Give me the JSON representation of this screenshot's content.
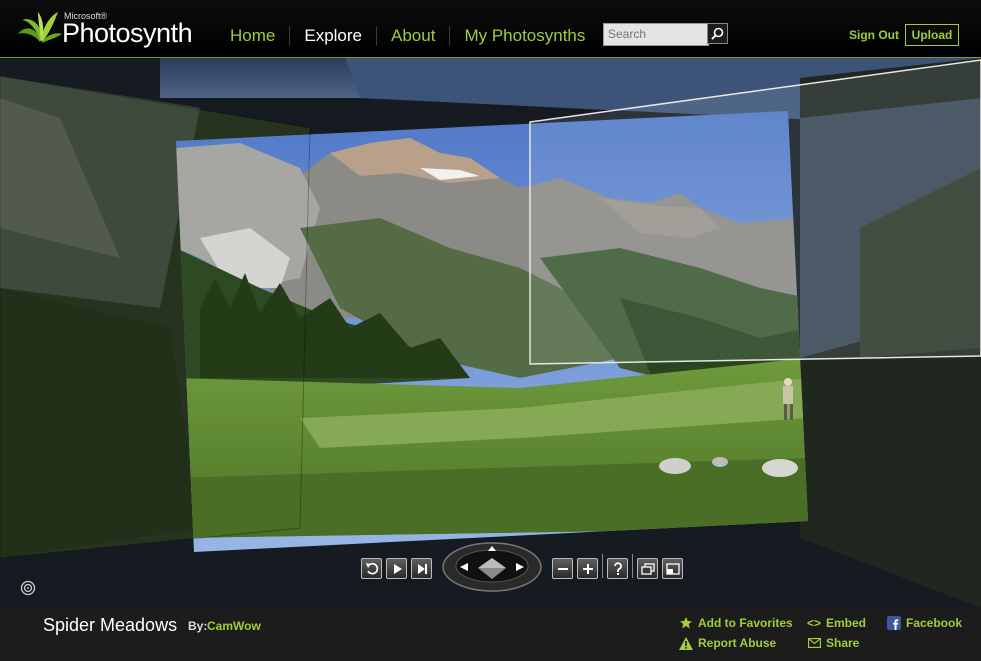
{
  "brand": {
    "small": "Microsoft®",
    "name": "Photosynth"
  },
  "nav": [
    {
      "label": "Home",
      "active": false
    },
    {
      "label": "Explore",
      "active": true
    },
    {
      "label": "About",
      "active": false
    },
    {
      "label": "My Photosynths",
      "active": false
    }
  ],
  "search": {
    "placeholder": "Search",
    "value": ""
  },
  "account": {
    "sign_out": "Sign Out",
    "upload": "Upload"
  },
  "viewer": {
    "controls": [
      "undo-icon",
      "play-icon",
      "next-icon",
      "navigation-pad",
      "zoom-out-icon",
      "zoom-in-icon",
      "help-icon",
      "overview-icon",
      "fullscreen-icon"
    ]
  },
  "synth": {
    "title": "Spider Meadows",
    "by_label": "By:",
    "author": "CamWow"
  },
  "actions": {
    "favorites": "Add to Favorites",
    "report": "Report Abuse",
    "embed": "Embed",
    "share": "Share",
    "facebook": "Facebook"
  },
  "colors": {
    "accent": "#9fce3a",
    "footer_bg": "#1c1c1c",
    "header_bg": "#000000"
  }
}
